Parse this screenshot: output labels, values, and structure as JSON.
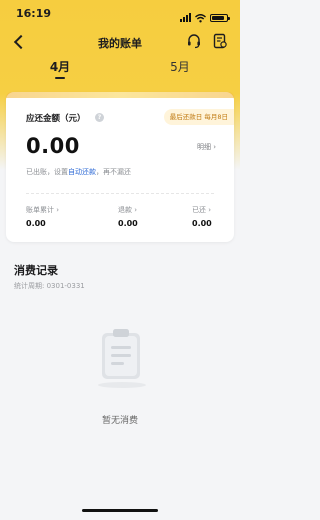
{
  "status_bar": {
    "time": "16:19"
  },
  "nav": {
    "title": "我的账单"
  },
  "months": [
    "4月",
    "5月"
  ],
  "summary": {
    "label": "应还金额（元）",
    "help_glyph": "?",
    "due_badge": "最后还款日 每月8日",
    "amount": "0.00",
    "detail": "明细 ›",
    "note_prefix": "已出账，设置",
    "note_link": "自动还款",
    "note_suffix": "，再不漏还",
    "stats": [
      {
        "label": "账单累计 ›",
        "value": "0.00"
      },
      {
        "label": "退款 ›",
        "value": "0.00"
      },
      {
        "label": "已还 ›",
        "value": "0.00"
      }
    ]
  },
  "records": {
    "title": "消费记录",
    "period": "统计周期: 0301-0331",
    "empty_text": "暂无消费"
  },
  "colors": {
    "brand_yellow": "#f6cd3f",
    "link_blue": "#2e6ad6",
    "badge_text": "#c07a12"
  },
  "icons": [
    "back-icon",
    "headset-icon",
    "bill-icon",
    "help-icon",
    "clipboard-empty-icon"
  ]
}
